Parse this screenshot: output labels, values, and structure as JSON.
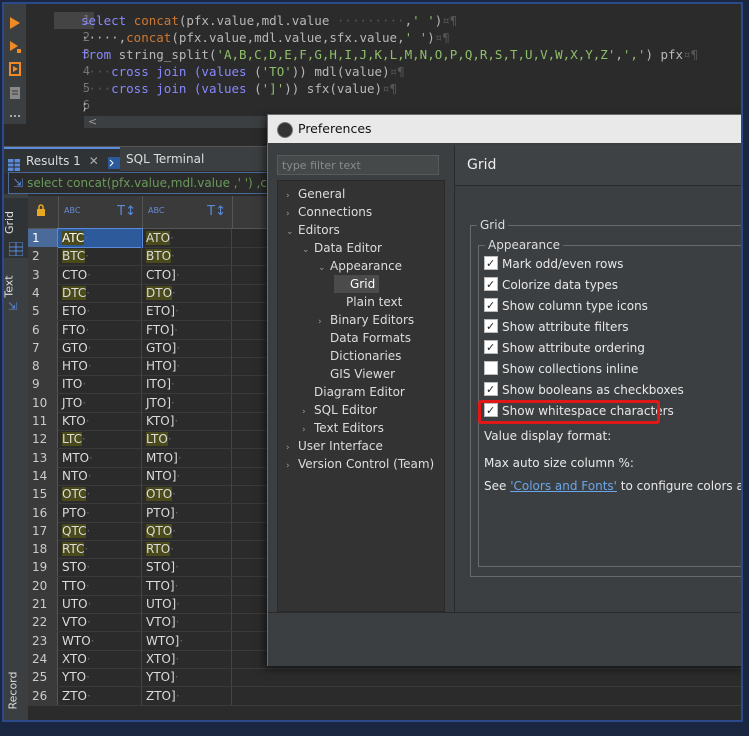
{
  "editor": {
    "line_numbers": [
      "1",
      "2",
      "3",
      "4",
      "5",
      "6"
    ],
    "lines": [
      [
        {
          "t": "select ",
          "c": "kw"
        },
        {
          "t": "concat",
          "c": "fn"
        },
        {
          "t": "(pfx.value,mdl.value ",
          "c": "nm"
        },
        {
          "t": "·········",
          "c": "ws"
        },
        {
          "t": ",",
          "c": "nm"
        },
        {
          "t": "' '",
          "c": "st"
        },
        {
          "t": ")",
          "c": "nm"
        },
        {
          "t": "¤¶",
          "c": "ws"
        }
      ],
      [
        {
          "t": "·····,",
          "c": "nm"
        },
        {
          "t": "concat",
          "c": "fn"
        },
        {
          "t": "(pfx.value,mdl.value,sfx.value,",
          "c": "nm"
        },
        {
          "t": "' '",
          "c": "st"
        },
        {
          "t": ")",
          "c": "nm"
        },
        {
          "t": "¤¶",
          "c": "ws"
        }
      ],
      [
        {
          "t": "from ",
          "c": "kw"
        },
        {
          "t": "string_split(",
          "c": "nm"
        },
        {
          "t": "'A,B,C,D,E,F,G,H,I,J,K,L,M,N,O,P,Q,R,S,T,U,V,W,X,Y,Z'",
          "c": "st"
        },
        {
          "t": ",",
          "c": "nm"
        },
        {
          "t": "','",
          "c": "st"
        },
        {
          "t": ") pfx",
          "c": "nm"
        },
        {
          "t": "¤¶",
          "c": "ws"
        }
      ],
      [
        {
          "t": "····",
          "c": "ws"
        },
        {
          "t": "cross join ",
          "c": "kw"
        },
        {
          "t": "(values ",
          "c": "kw"
        },
        {
          "t": "(",
          "c": "nm"
        },
        {
          "t": "'TO'",
          "c": "st"
        },
        {
          "t": ")) mdl(value)",
          "c": "nm"
        },
        {
          "t": "¤¶",
          "c": "ws"
        }
      ],
      [
        {
          "t": "····",
          "c": "ws"
        },
        {
          "t": "cross join ",
          "c": "kw"
        },
        {
          "t": "(values ",
          "c": "kw"
        },
        {
          "t": "(",
          "c": "nm"
        },
        {
          "t": "']'",
          "c": "st"
        },
        {
          "t": ")) sfx(value)",
          "c": "nm"
        },
        {
          "t": "¤¶",
          "c": "ws"
        }
      ],
      [
        {
          "t": ";",
          "c": "nm"
        }
      ]
    ],
    "scroll_glyph": "<"
  },
  "tabs": {
    "results": "Results 1",
    "close": "✕",
    "terminal": "SQL Terminal"
  },
  "filter_text": "select concat(pfx.value,mdl.value ,' ') ,concat(",
  "side_tabs": {
    "grid": "Grid",
    "text": "Text",
    "record": "Record"
  },
  "grid": {
    "rows": [
      {
        "n": "1",
        "a": "ATC",
        "b": "ATO",
        "y": true
      },
      {
        "n": "2",
        "a": "BTC",
        "b": "BTO",
        "y": true
      },
      {
        "n": "3",
        "a": "CTO",
        "b": "CTO]",
        "y": false
      },
      {
        "n": "4",
        "a": "DTC",
        "b": "DTO",
        "y": true
      },
      {
        "n": "5",
        "a": "ETO",
        "b": "ETO]",
        "y": false
      },
      {
        "n": "6",
        "a": "FTO",
        "b": "FTO]",
        "y": false
      },
      {
        "n": "7",
        "a": "GTO",
        "b": "GTO]",
        "y": false
      },
      {
        "n": "8",
        "a": "HTO",
        "b": "HTO]",
        "y": false
      },
      {
        "n": "9",
        "a": "ITO",
        "b": "ITO]",
        "y": false
      },
      {
        "n": "10",
        "a": "JTO",
        "b": "JTO]",
        "y": false
      },
      {
        "n": "11",
        "a": "KTO",
        "b": "KTO]",
        "y": false
      },
      {
        "n": "12",
        "a": "LTC",
        "b": "LTO",
        "y": true
      },
      {
        "n": "13",
        "a": "MTO",
        "b": "MTO]",
        "y": false
      },
      {
        "n": "14",
        "a": "NTO",
        "b": "NTO]",
        "y": false
      },
      {
        "n": "15",
        "a": "OTC",
        "b": "OTO",
        "y": true
      },
      {
        "n": "16",
        "a": "PTO",
        "b": "PTO]",
        "y": false
      },
      {
        "n": "17",
        "a": "QTC",
        "b": "QTO",
        "y": true
      },
      {
        "n": "18",
        "a": "RTC",
        "b": "RTO",
        "y": true
      },
      {
        "n": "19",
        "a": "STO",
        "b": "STO]",
        "y": false
      },
      {
        "n": "20",
        "a": "TTO",
        "b": "TTO]",
        "y": false
      },
      {
        "n": "21",
        "a": "UTO",
        "b": "UTO]",
        "y": false
      },
      {
        "n": "22",
        "a": "VTO",
        "b": "VTO]",
        "y": false
      },
      {
        "n": "23",
        "a": "WTO",
        "b": "WTO]",
        "y": false
      },
      {
        "n": "24",
        "a": "XTO",
        "b": "XTO]",
        "y": false
      },
      {
        "n": "25",
        "a": "YTO",
        "b": "YTO]",
        "y": false
      },
      {
        "n": "26",
        "a": "ZTO",
        "b": "ZTO]",
        "y": false
      }
    ],
    "abc_label": "ABC"
  },
  "dialog": {
    "title": "Preferences",
    "filter_placeholder": "type filter text",
    "tree": [
      {
        "label": "General",
        "indent": 0,
        "arrow": "›"
      },
      {
        "label": "Connections",
        "indent": 0,
        "arrow": "›"
      },
      {
        "label": "Editors",
        "indent": 0,
        "arrow": "⌄"
      },
      {
        "label": "Data Editor",
        "indent": 1,
        "arrow": "⌄"
      },
      {
        "label": "Appearance",
        "indent": 2,
        "arrow": "⌄"
      },
      {
        "label": "Grid",
        "indent": 3,
        "arrow": "",
        "sel": true
      },
      {
        "label": "Plain text",
        "indent": 3,
        "arrow": ""
      },
      {
        "label": "Binary Editors",
        "indent": 2,
        "arrow": "›"
      },
      {
        "label": "Data Formats",
        "indent": 2,
        "arrow": ""
      },
      {
        "label": "Dictionaries",
        "indent": 2,
        "arrow": ""
      },
      {
        "label": "GIS Viewer",
        "indent": 2,
        "arrow": ""
      },
      {
        "label": "Diagram Editor",
        "indent": 1,
        "arrow": ""
      },
      {
        "label": "SQL Editor",
        "indent": 1,
        "arrow": "›"
      },
      {
        "label": "Text Editors",
        "indent": 1,
        "arrow": "›"
      },
      {
        "label": "User Interface",
        "indent": 0,
        "arrow": "›"
      },
      {
        "label": "Version Control (Team)",
        "indent": 0,
        "arrow": "›"
      }
    ],
    "page_title": "Grid",
    "group_label": "Grid",
    "subgroup_label": "Appearance",
    "checkboxes": [
      {
        "label": "Mark odd/even rows",
        "checked": true
      },
      {
        "label": "Colorize data types",
        "checked": true
      },
      {
        "label": "Show column type icons",
        "checked": true
      },
      {
        "label": "Show attribute filters",
        "checked": true
      },
      {
        "label": "Show attribute ordering",
        "checked": true
      },
      {
        "label": "Show collections inline",
        "checked": false
      },
      {
        "label": "Show booleans as checkboxes",
        "checked": true
      },
      {
        "label": "Show whitespace characters",
        "checked": true
      }
    ],
    "value_display_label": "Value display format:",
    "max_auto_label": "Max auto size column %:",
    "see_prefix": "See ",
    "see_link": "'Colors and Fonts'",
    "see_suffix": " to configure colors and for"
  }
}
